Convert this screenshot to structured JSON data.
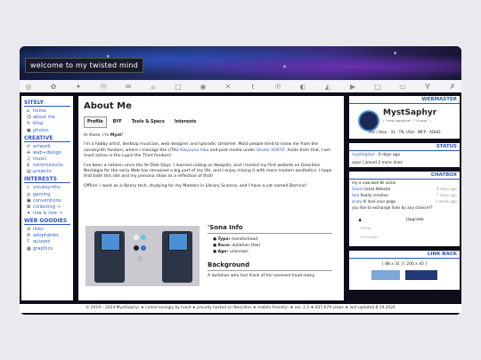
{
  "banner": {
    "title": "welcome to my twisted mind"
  },
  "iconbar": {
    "icons": [
      "◎",
      "✿",
      "✦",
      "ⓜ",
      "✉",
      "☕",
      "▢",
      "◉",
      "✕",
      "t",
      "℗",
      "◐",
      "◭",
      "▶",
      "□",
      "▭",
      "Ɐ",
      "✗"
    ]
  },
  "sidebar": {
    "sitely_heading": "SITELY",
    "sitely": [
      {
        "icon": "⌂",
        "label": "home"
      },
      {
        "icon": "☺",
        "label": "about me"
      },
      {
        "icon": "✎",
        "label": "blog"
      },
      {
        "icon": "▣",
        "label": "photos"
      }
    ],
    "creative_heading": "CREATIVE",
    "creative": [
      {
        "icon": "✐",
        "label": "artwork"
      },
      {
        "icon": "✢",
        "label": "web+design"
      },
      {
        "icon": "♫",
        "label": "music"
      },
      {
        "icon": "$",
        "label": "commissions"
      },
      {
        "icon": "▤",
        "label": "projects"
      }
    ],
    "interests_heading": "INTERESTS",
    "interests": [
      {
        "icon": "♪",
        "label": "vocalsynths"
      },
      {
        "icon": "◎",
        "label": "gaming"
      },
      {
        "icon": "▣",
        "label": "conventions"
      },
      {
        "icon": "✿",
        "label": "collecting →"
      },
      {
        "icon": "✦",
        "label": "lore & lore →"
      }
    ],
    "goodies_heading": "WEB GOODIES",
    "goodies": [
      {
        "icon": "⊘",
        "label": "links"
      },
      {
        "icon": "✉",
        "label": "adoptables"
      },
      {
        "icon": "?",
        "label": "quizzes"
      },
      {
        "icon": "▦",
        "label": "graphics"
      }
    ]
  },
  "main": {
    "title": "About Me",
    "tabs": [
      "Profile",
      "BYF",
      "Tools & Specs",
      "Interests"
    ],
    "greeting": "Hi there, I'm ",
    "name": "Myst",
    "greeting_end": "!",
    "p1": "I'm a hobby artist, desktop musician, web designer and sporadic streamer. Most people tend to know me from the vocalsynth fandom, where I manage the UTAU ",
    "p1_link1": "Kikyoune Aiko",
    "p1_mid": " and post media under ",
    "p1_link2": "Studio VOXYZ",
    "p1_end": ". Aside from that, I am most active in the Lupin the Third fandom!",
    "p2": "I've been a netizen since the Ye Olde Days: I learned coding on Neopets, and I hosted my first website on Geocities. Nostalgia for the early Web has remained a big part of my life, and I enjoy mixing it with more modern aesthetics. I hope that both this site and my persona show as a reflection of that!",
    "p3": "Offline: I work as a library tech, studying for my Masters in Library Science, and I have a cat named Domino!",
    "sona": {
      "title": "'Sona Info",
      "rows": [
        {
          "k": "Type:",
          "v": "monitorhead"
        },
        {
          "k": "Race:",
          "v": "dullahan (fae)"
        },
        {
          "k": "Age:",
          "v": "unknown"
        }
      ],
      "bg_title": "Background",
      "bg_text": "A dullahan who lost track of her severed head many"
    }
  },
  "right": {
    "webmaster": {
      "heading": "WEBMASTER",
      "name": "MystSaphyr",
      "subtitle": "( \"mist sapphire\" / \"n sass\" )",
      "info": "she / they · 33 · TN, USA · INFP · ADHD"
    },
    "status": {
      "heading": "STATUS",
      "user": "mystsaphyr",
      "time": "6 days ago",
      "text": "oops I joined 2 more dnes"
    },
    "chatbox": {
      "heading": "CHATBOX",
      "messages": [
        {
          "user": "",
          "text": "my a now wall 8il some",
          "time": ""
        },
        {
          "user": "Ghost",
          "text": "Great Website",
          "time": "6 days ago"
        },
        {
          "user": "tam",
          "text": "Really creative",
          "time": "7 days ago"
        },
        {
          "user": "scuty",
          "text": "hi love your page",
          "time": "1 week ago"
        },
        {
          "user": "",
          "text": "you like to exchange links by any chance??",
          "time": ""
        }
      ],
      "upgrade": "Upgrade",
      "name_placeholder": "name",
      "msg_placeholder": "message"
    },
    "linkback": {
      "heading": "LINK BACK",
      "sizes": "[ 88 x 31 ]   [ 200 x 40 ]"
    }
  },
  "footer": {
    "text": "© 2019 – 2024 MystSaphyr  ★ coded lovingly by hand  ★ proudly hosted on Neocities  ★ mobile friendly!  ★ ver. 2.2  ★ 837,679 views  ★ last updated 8.19.2024"
  }
}
